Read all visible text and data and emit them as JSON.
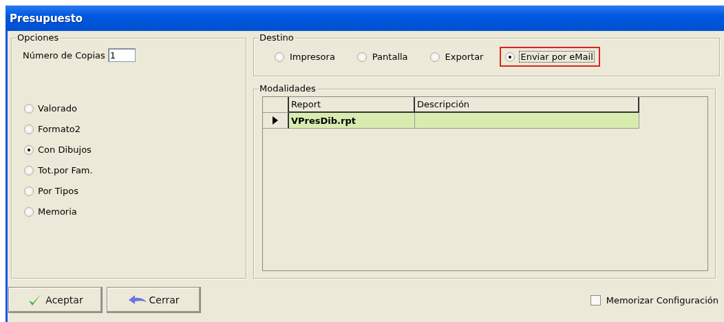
{
  "window": {
    "title": "Presupuesto"
  },
  "opciones": {
    "title": "Opciones",
    "copies_label": "Número de Copias",
    "copies_value": "1",
    "formats": [
      {
        "label": "Valorado",
        "selected": false
      },
      {
        "label": "Formato2",
        "selected": false
      },
      {
        "label": "Con Dibujos",
        "selected": true
      },
      {
        "label": "Tot.por Fam.",
        "selected": false
      },
      {
        "label": "Por Tipos",
        "selected": false
      },
      {
        "label": "Memoria",
        "selected": false
      }
    ]
  },
  "destino": {
    "title": "Destino",
    "options": [
      {
        "label": "Impresora",
        "selected": false,
        "focused": false,
        "highlighted": false
      },
      {
        "label": "Pantalla",
        "selected": false,
        "focused": false,
        "highlighted": false
      },
      {
        "label": "Exportar",
        "selected": false,
        "focused": false,
        "highlighted": false
      },
      {
        "label": "Enviar por eMail",
        "selected": true,
        "focused": true,
        "highlighted": true
      }
    ]
  },
  "modalidades": {
    "title": "Modalidades",
    "columns": [
      "Report",
      "Descripción"
    ],
    "rows": [
      {
        "cells": [
          "VPresDib.rpt",
          ""
        ],
        "selected": true
      }
    ]
  },
  "buttons": [
    {
      "label": "Aceptar",
      "kind": "accept"
    },
    {
      "label": "Cerrar",
      "kind": "close"
    }
  ],
  "memorize": {
    "label": "Memorizar Configuración",
    "checked": false
  }
}
